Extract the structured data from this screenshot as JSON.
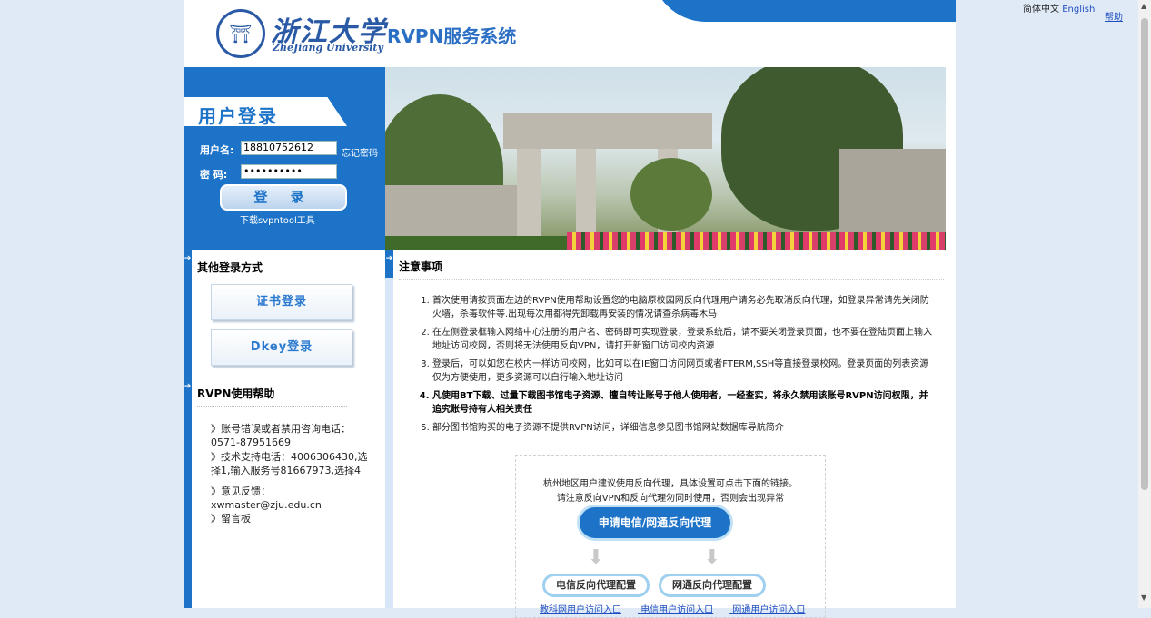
{
  "header": {
    "logo_seal_glyph": "⛩",
    "logo_cn": "浙江大学",
    "logo_en": "ZheJiang University",
    "system_title": "RVPN服务系统"
  },
  "lang": {
    "zh": "简体中文",
    "en": "English"
  },
  "help_link": "帮助",
  "login": {
    "banner": "用户登录",
    "username_label": "用户名:",
    "username_value": "18810752612",
    "password_label": "密  码:",
    "password_value": "••••••••••",
    "forgot": "忘记密码",
    "login_button": "登 录",
    "download": "下载svpntool工具"
  },
  "other_login": {
    "heading": "其他登录方式",
    "cert_button": "证书登录",
    "dkey_button": "Dkey登录"
  },
  "help": {
    "heading": "RVPN使用帮助",
    "items": [
      "》账号错误或者禁用咨询电话：0571-87951669",
      "》技术支持电话：4006306430,选择1,输入服务号81667973,选择4",
      "》意见反馈：xwmaster@zju.edu.cn",
      "》留言板"
    ]
  },
  "notice": {
    "heading": "注意事项",
    "items": [
      "首次使用请按页面左边的RVPN使用帮助设置您的电脑原校园网反向代理用户请务必先取消反向代理，如登录异常请先关闭防火墙，杀毒软件等.出现每次用都得先卸载再安装的情况请查杀病毒木马",
      "在左侧登录框输入网络中心注册的用户名、密码即可实现登录，登录系统后，请不要关闭登录页面，也不要在登陆页面上输入地址访问校网，否则将无法使用反向VPN，请打开新窗口访问校内资源",
      "登录后，可以如您在校内一样访问校网，比如可以在IE窗口访问网页或者FTERM,SSH等直接登录校网。登录页面的列表资源仅为方便使用，更多资源可以自行输入地址访问",
      "凡使用BT下载、过量下载图书馆电子资源、擅自转让账号于他人使用者，一经查实，将永久禁用该账号RVPN访问权限，并追究账号持有人相关责任",
      "部分图书馆购买的电子资源不提供RVPN访问，详细信息参见图书馆网站数据库导航简介"
    ]
  },
  "proxy": {
    "line1": "杭州地区用户建议使用反向代理，具体设置可点击下面的链接。",
    "line2": "请注意反向VPN和反向代理勿同时使用，否则会出现异常",
    "apply_button": "申请电信/网通反向代理",
    "telecom_config": "电信反向代理配置",
    "netcom_config": "网通反向代理配置",
    "links": [
      "教科网用户访问入口",
      "电信用户访问入口",
      "网通用户访问入口"
    ]
  }
}
